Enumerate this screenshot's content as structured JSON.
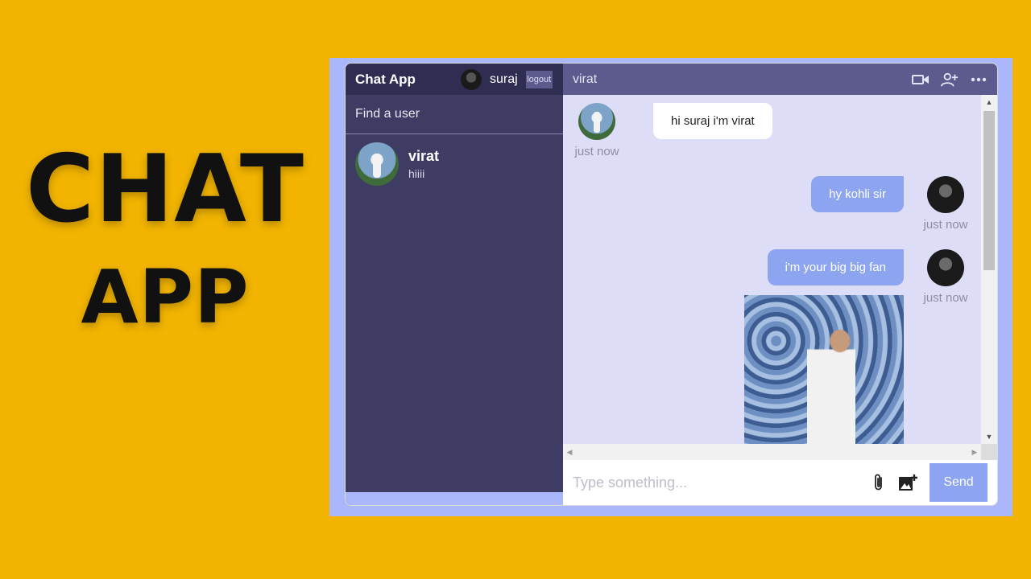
{
  "poster": {
    "line1": "CHAT",
    "line2": "APP"
  },
  "navbar": {
    "brand": "Chat App",
    "user_name": "suraj",
    "logout_label": "logout"
  },
  "search": {
    "placeholder": "Find a user"
  },
  "user_chats": [
    {
      "name": "virat",
      "last_message": "hiiii"
    }
  ],
  "chat": {
    "title": "virat",
    "icons": [
      "video-camera-icon",
      "add-user-icon",
      "more-icon"
    ],
    "messages": [
      {
        "sender": "virat",
        "owner": false,
        "text": "hi suraj i'm virat",
        "time": "just now"
      },
      {
        "sender": "suraj",
        "owner": true,
        "text": "hy kohli sir",
        "time": "just now"
      },
      {
        "sender": "suraj",
        "owner": true,
        "text": "i'm your big big fan",
        "time": "just now",
        "has_image": true
      }
    ]
  },
  "input": {
    "placeholder": "Type something...",
    "send_label": "Send"
  },
  "colors": {
    "background": "#f2b400",
    "sidebar": "#3e3c62",
    "navbar": "#2f2d52",
    "chat_header": "#5d5b8d",
    "chat_bg": "#ddddf7",
    "owner_bubble": "#8da4f1"
  }
}
